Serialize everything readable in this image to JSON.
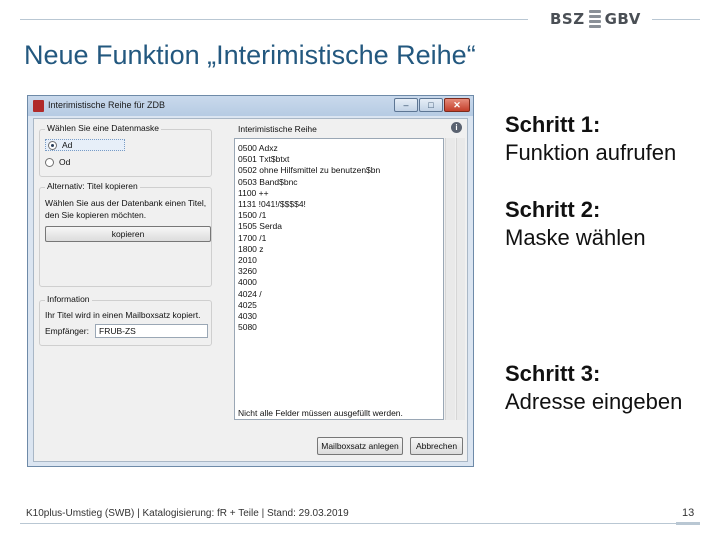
{
  "header": {
    "logo_left": "BSZ",
    "logo_right": "GBV",
    "title": "Neue Funktion „Interimistische Reihe“"
  },
  "dialog": {
    "title": "Interimistische Reihe für ZDB",
    "controls": {
      "minimize": "‒",
      "maximize": "□",
      "close": "✕"
    },
    "mask_group": {
      "label": "Wählen Sie eine Datenmaske",
      "options": [
        "Ad",
        "Od"
      ],
      "selected": "Ad"
    },
    "copy_group": {
      "label": "Alternativ: Titel kopieren",
      "text": "Wählen Sie aus der Datenbank einen Titel, den Sie kopieren möchten.",
      "button": "kopieren"
    },
    "info_group": {
      "label": "Information",
      "text": "Ihr Titel wird in einen Mailboxsatz kopiert.",
      "recipient_label": "Empfänger:",
      "recipient_value": "FRUB-ZS"
    },
    "list": {
      "label": "Interimistische Reihe",
      "items": [
        "0500 Adxz",
        "0501 Txt$btxt",
        "0502 ohne Hilfsmittel zu benutzen$bn",
        "0503 Band$bnc",
        "1100 ++",
        "1131 !041!/$$$$4!",
        "1500 /1",
        "1505 Serda",
        "1700 /1",
        "1800 z",
        "2010",
        "3260",
        "4000",
        "4024 /",
        "4025",
        "4030",
        "5080"
      ],
      "note": "Nicht alle Felder müssen ausgefüllt werden."
    },
    "help": "i",
    "buttons": {
      "mailbox": "Mailboxsatz anlegen",
      "cancel": "Abbrechen"
    }
  },
  "steps": [
    {
      "title": "Schritt 1:",
      "desc": "Funktion aufrufen"
    },
    {
      "title": "Schritt 2:",
      "desc": "Maske wählen"
    },
    {
      "title": "Schritt 3:",
      "desc": "Adresse eingeben"
    }
  ],
  "footer": {
    "text": "K10plus-Umstieg (SWB) | Katalogisierung: fR + Teile | Stand: 29.03.2019",
    "page": "13"
  },
  "colors": {
    "title": "#23587f",
    "rule": "#b9c7d3",
    "window_border": "#6e8aa8"
  }
}
